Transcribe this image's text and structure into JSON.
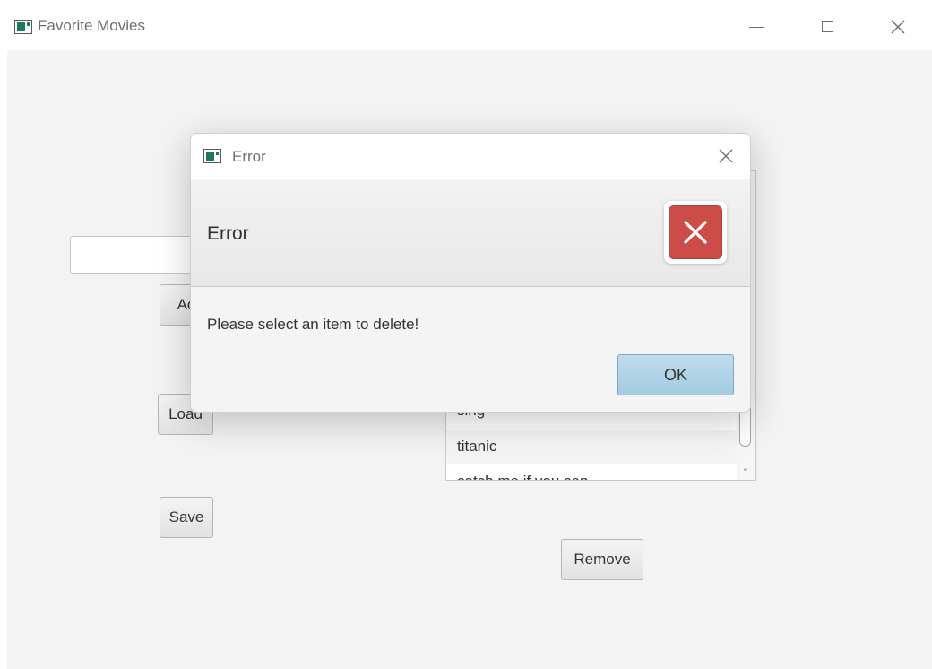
{
  "window": {
    "title": "Favorite Movies",
    "icon": "app-window-icon",
    "controls": [
      "minimize-icon",
      "maximize-icon",
      "close-icon"
    ]
  },
  "form": {
    "text_field_value": "",
    "add_label": "Ad",
    "load_label": "Load",
    "save_label": "Save",
    "remove_label": "Remove"
  },
  "list": {
    "items": [
      "sing",
      "titanic",
      "catch me if you can"
    ]
  },
  "dialog": {
    "title": "Error",
    "header_text": "Error",
    "content_text": "Please select an item to delete!",
    "ok_label": "OK",
    "icon": "error-x-icon"
  },
  "colors": {
    "error_red": "#cc4d48",
    "ok_button": "#a4cbe2",
    "background": "#f3f3f3"
  }
}
